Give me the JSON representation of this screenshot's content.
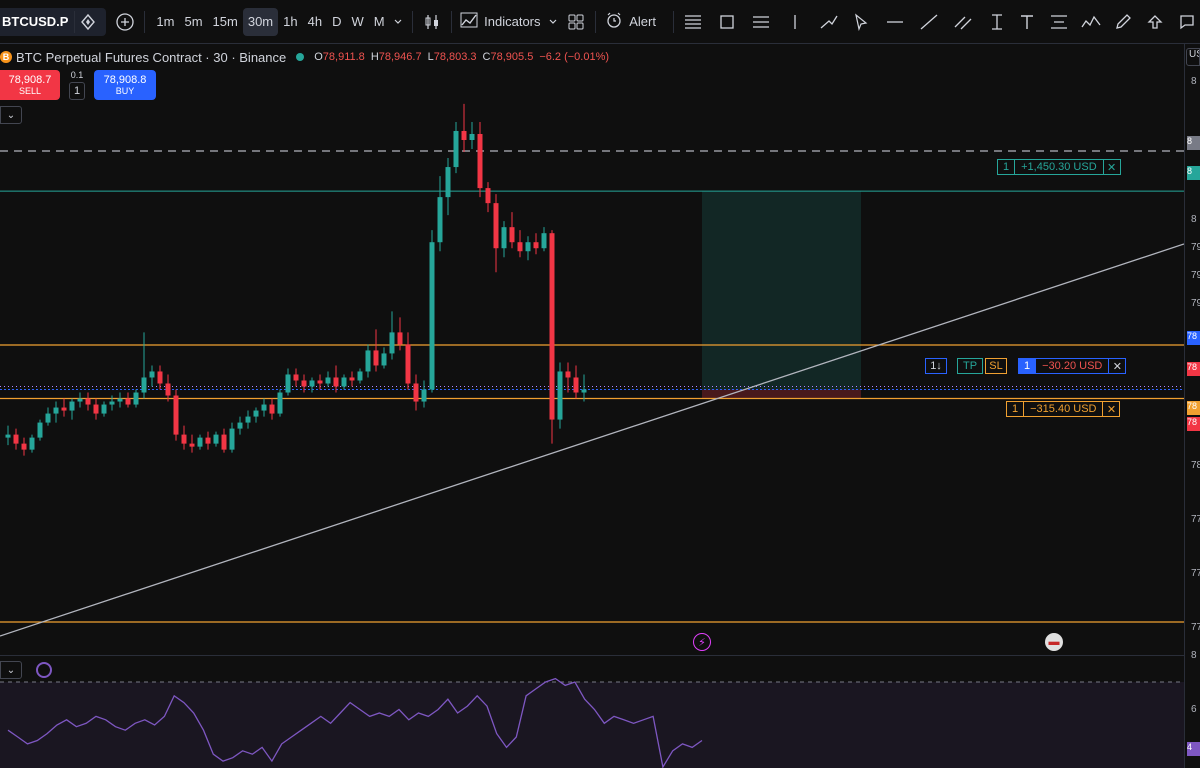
{
  "toolbar": {
    "symbol": "BTCUSD.P",
    "intervals": [
      "1m",
      "5m",
      "15m",
      "30m",
      "1h",
      "4h",
      "D",
      "W",
      "M"
    ],
    "active_interval": "30m",
    "indicators_label": "Indicators",
    "alert_label": "Alert"
  },
  "legend": {
    "title": "BTC Perpetual Futures Contract · 30 · Binance",
    "coin_letter": "B",
    "open_key": "O",
    "open": "78,911.8",
    "high_key": "H",
    "high": "78,946.7",
    "low_key": "L",
    "low": "78,803.3",
    "close_key": "C",
    "close": "78,905.5",
    "change": "−6.2 (−0.01%)"
  },
  "trade": {
    "sell_price": "78,908.7",
    "sell_label": "SELL",
    "qty_step": "0.1",
    "qty": "1",
    "buy_price": "78,908.8",
    "buy_label": "BUY"
  },
  "positions": {
    "take_profit": {
      "qty": "1",
      "amount": "+1,450.30 USD"
    },
    "entry": {
      "qty": "1",
      "amount": "−30.20 USD",
      "tp_tag": "TP",
      "sl_tag": "SL",
      "flip_tag": "1↓"
    },
    "stop_loss": {
      "qty": "1",
      "amount": "−315.40 USD"
    }
  },
  "axis": {
    "unit_label": "USD",
    "ticks": [
      "8",
      "8",
      "8",
      "8",
      "79",
      "79",
      "79",
      "78",
      "78",
      "78",
      "78",
      "78",
      "77",
      "77",
      "77",
      "8",
      "6",
      "4"
    ]
  },
  "chart_data": {
    "type": "candlestick",
    "series": [
      {
        "o": 78.6,
        "h": 78.68,
        "l": 78.55,
        "c": 78.62
      },
      {
        "o": 78.62,
        "h": 78.66,
        "l": 78.52,
        "c": 78.56
      },
      {
        "o": 78.56,
        "h": 78.6,
        "l": 78.48,
        "c": 78.52
      },
      {
        "o": 78.52,
        "h": 78.62,
        "l": 78.5,
        "c": 78.6
      },
      {
        "o": 78.6,
        "h": 78.72,
        "l": 78.58,
        "c": 78.7
      },
      {
        "o": 78.7,
        "h": 78.8,
        "l": 78.68,
        "c": 78.76
      },
      {
        "o": 78.76,
        "h": 78.84,
        "l": 78.7,
        "c": 78.8
      },
      {
        "o": 78.8,
        "h": 78.86,
        "l": 78.74,
        "c": 78.78
      },
      {
        "o": 78.78,
        "h": 78.86,
        "l": 78.72,
        "c": 78.84
      },
      {
        "o": 78.84,
        "h": 78.9,
        "l": 78.8,
        "c": 78.86
      },
      {
        "o": 78.86,
        "h": 78.9,
        "l": 78.78,
        "c": 78.82
      },
      {
        "o": 78.82,
        "h": 78.86,
        "l": 78.72,
        "c": 78.76
      },
      {
        "o": 78.76,
        "h": 78.84,
        "l": 78.74,
        "c": 78.82
      },
      {
        "o": 78.82,
        "h": 78.88,
        "l": 78.78,
        "c": 78.84
      },
      {
        "o": 78.84,
        "h": 78.9,
        "l": 78.8,
        "c": 78.86
      },
      {
        "o": 78.86,
        "h": 78.9,
        "l": 78.8,
        "c": 78.82
      },
      {
        "o": 78.82,
        "h": 78.92,
        "l": 78.8,
        "c": 78.9
      },
      {
        "o": 78.9,
        "h": 79.3,
        "l": 78.86,
        "c": 79.0
      },
      {
        "o": 79.0,
        "h": 79.08,
        "l": 78.94,
        "c": 79.04
      },
      {
        "o": 79.04,
        "h": 79.08,
        "l": 78.92,
        "c": 78.96
      },
      {
        "o": 78.96,
        "h": 79.02,
        "l": 78.84,
        "c": 78.88
      },
      {
        "o": 78.88,
        "h": 78.92,
        "l": 78.58,
        "c": 78.62
      },
      {
        "o": 78.62,
        "h": 78.68,
        "l": 78.52,
        "c": 78.56
      },
      {
        "o": 78.56,
        "h": 78.62,
        "l": 78.5,
        "c": 78.54
      },
      {
        "o": 78.54,
        "h": 78.62,
        "l": 78.52,
        "c": 78.6
      },
      {
        "o": 78.6,
        "h": 78.64,
        "l": 78.52,
        "c": 78.56
      },
      {
        "o": 78.56,
        "h": 78.64,
        "l": 78.54,
        "c": 78.62
      },
      {
        "o": 78.62,
        "h": 78.66,
        "l": 78.5,
        "c": 78.52
      },
      {
        "o": 78.52,
        "h": 78.7,
        "l": 78.5,
        "c": 78.66
      },
      {
        "o": 78.66,
        "h": 78.74,
        "l": 78.62,
        "c": 78.7
      },
      {
        "o": 78.7,
        "h": 78.78,
        "l": 78.66,
        "c": 78.74
      },
      {
        "o": 78.74,
        "h": 78.8,
        "l": 78.7,
        "c": 78.78
      },
      {
        "o": 78.78,
        "h": 78.86,
        "l": 78.74,
        "c": 78.82
      },
      {
        "o": 78.82,
        "h": 78.86,
        "l": 78.72,
        "c": 78.76
      },
      {
        "o": 78.76,
        "h": 78.92,
        "l": 78.74,
        "c": 78.9
      },
      {
        "o": 78.9,
        "h": 79.06,
        "l": 78.88,
        "c": 79.02
      },
      {
        "o": 79.02,
        "h": 79.06,
        "l": 78.94,
        "c": 78.98
      },
      {
        "o": 78.98,
        "h": 79.02,
        "l": 78.9,
        "c": 78.94
      },
      {
        "o": 78.94,
        "h": 79.0,
        "l": 78.9,
        "c": 78.98
      },
      {
        "o": 78.98,
        "h": 79.02,
        "l": 78.92,
        "c": 78.96
      },
      {
        "o": 78.96,
        "h": 79.04,
        "l": 78.94,
        "c": 79.0
      },
      {
        "o": 79.0,
        "h": 79.08,
        "l": 78.9,
        "c": 78.94
      },
      {
        "o": 78.94,
        "h": 79.02,
        "l": 78.92,
        "c": 79.0
      },
      {
        "o": 79.0,
        "h": 79.04,
        "l": 78.94,
        "c": 78.98
      },
      {
        "o": 78.98,
        "h": 79.06,
        "l": 78.96,
        "c": 79.04
      },
      {
        "o": 79.04,
        "h": 79.22,
        "l": 79.0,
        "c": 79.18
      },
      {
        "o": 79.18,
        "h": 79.32,
        "l": 79.04,
        "c": 79.08
      },
      {
        "o": 79.08,
        "h": 79.2,
        "l": 79.06,
        "c": 79.16
      },
      {
        "o": 79.16,
        "h": 79.44,
        "l": 79.12,
        "c": 79.3
      },
      {
        "o": 79.3,
        "h": 79.4,
        "l": 79.18,
        "c": 79.22
      },
      {
        "o": 79.22,
        "h": 79.3,
        "l": 78.92,
        "c": 78.96
      },
      {
        "o": 78.96,
        "h": 79.02,
        "l": 78.78,
        "c": 78.84
      },
      {
        "o": 78.84,
        "h": 78.98,
        "l": 78.8,
        "c": 78.92
      },
      {
        "o": 78.92,
        "h": 79.98,
        "l": 78.9,
        "c": 79.9
      },
      {
        "o": 79.9,
        "h": 80.34,
        "l": 79.84,
        "c": 80.2
      },
      {
        "o": 80.2,
        "h": 80.46,
        "l": 80.08,
        "c": 80.4
      },
      {
        "o": 80.4,
        "h": 80.7,
        "l": 80.36,
        "c": 80.64
      },
      {
        "o": 80.64,
        "h": 80.82,
        "l": 80.5,
        "c": 80.58
      },
      {
        "o": 80.58,
        "h": 80.7,
        "l": 80.52,
        "c": 80.62
      },
      {
        "o": 80.62,
        "h": 80.7,
        "l": 80.2,
        "c": 80.26
      },
      {
        "o": 80.26,
        "h": 80.3,
        "l": 80.1,
        "c": 80.16
      },
      {
        "o": 80.16,
        "h": 80.22,
        "l": 79.7,
        "c": 79.86
      },
      {
        "o": 79.86,
        "h": 80.04,
        "l": 79.8,
        "c": 80.0
      },
      {
        "o": 80.0,
        "h": 80.1,
        "l": 79.86,
        "c": 79.9
      },
      {
        "o": 79.9,
        "h": 79.98,
        "l": 79.8,
        "c": 79.84
      },
      {
        "o": 79.84,
        "h": 79.94,
        "l": 79.78,
        "c": 79.9
      },
      {
        "o": 79.9,
        "h": 79.96,
        "l": 79.82,
        "c": 79.86
      },
      {
        "o": 79.86,
        "h": 80.0,
        "l": 79.84,
        "c": 79.96
      },
      {
        "o": 79.96,
        "h": 79.98,
        "l": 78.56,
        "c": 78.72
      },
      {
        "o": 78.72,
        "h": 79.1,
        "l": 78.66,
        "c": 79.04
      },
      {
        "o": 79.04,
        "h": 79.1,
        "l": 78.9,
        "c": 79.0
      },
      {
        "o": 79.0,
        "h": 79.08,
        "l": 78.86,
        "c": 78.9
      },
      {
        "o": 78.9,
        "h": 79.02,
        "l": 78.84,
        "c": 78.92
      }
    ],
    "ylim": [
      77.32,
      80.58
    ],
    "tp_price": 80.24,
    "stop_price": 78.86,
    "entry_price": 78.92,
    "rsi": [
      52,
      48,
      44,
      46,
      50,
      55,
      58,
      54,
      56,
      60,
      58,
      54,
      52,
      56,
      58,
      55,
      60,
      72,
      68,
      62,
      52,
      38,
      34,
      36,
      40,
      38,
      42,
      34,
      44,
      48,
      52,
      56,
      60,
      56,
      62,
      68,
      64,
      60,
      62,
      60,
      64,
      58,
      62,
      60,
      64,
      70,
      62,
      66,
      72,
      66,
      50,
      42,
      48,
      72,
      76,
      80,
      82,
      78,
      80,
      70,
      64,
      56,
      60,
      58,
      56,
      58,
      60,
      30,
      40,
      44,
      42,
      46
    ]
  }
}
